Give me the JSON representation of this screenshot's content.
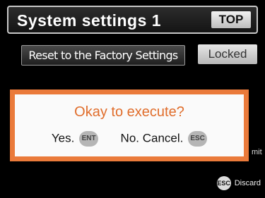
{
  "header": {
    "title": "System settings 1",
    "top_button": "TOP"
  },
  "reset_row": {
    "reset_button": "Reset to the Factory Settings",
    "status": "Locked"
  },
  "dialog": {
    "message": "Okay to execute?",
    "yes_label": "Yes.",
    "yes_key": "ENT",
    "no_label": "No. Cancel.",
    "no_key": "ESC"
  },
  "background_partial_text": "mit",
  "footer": {
    "esc_key": "ESC",
    "discard_label": "Discard"
  },
  "colors": {
    "dialog_border": "#ea7a3a",
    "dialog_message": "#e06d2b",
    "background": "#000000"
  }
}
